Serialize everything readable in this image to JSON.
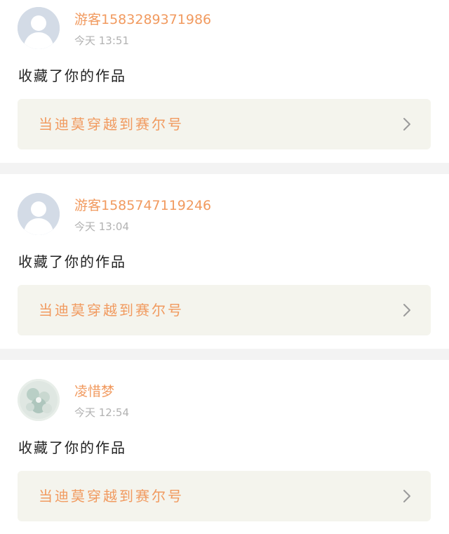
{
  "notifications": [
    {
      "username": "游客1583289371986",
      "time": "今天 13:51",
      "action": "收藏了你的作品",
      "work_title": "当迪莫穿越到赛尔号",
      "avatar": "default-avatar-icon"
    },
    {
      "username": "游客1585747119246",
      "time": "今天 13:04",
      "action": "收藏了你的作品",
      "work_title": "当迪莫穿越到赛尔号",
      "avatar": "default-avatar-icon"
    },
    {
      "username": "凌惜梦",
      "time": "今天 12:54",
      "action": "收藏了你的作品",
      "work_title": "当迪莫穿越到赛尔号",
      "avatar": "user-photo-avatar"
    }
  ],
  "colors": {
    "accent": "#f19a5f",
    "time": "#b2b2b2",
    "body_text": "#222222",
    "link_card_bg": "#f4f4ed",
    "separator": "#f3f3f3"
  }
}
